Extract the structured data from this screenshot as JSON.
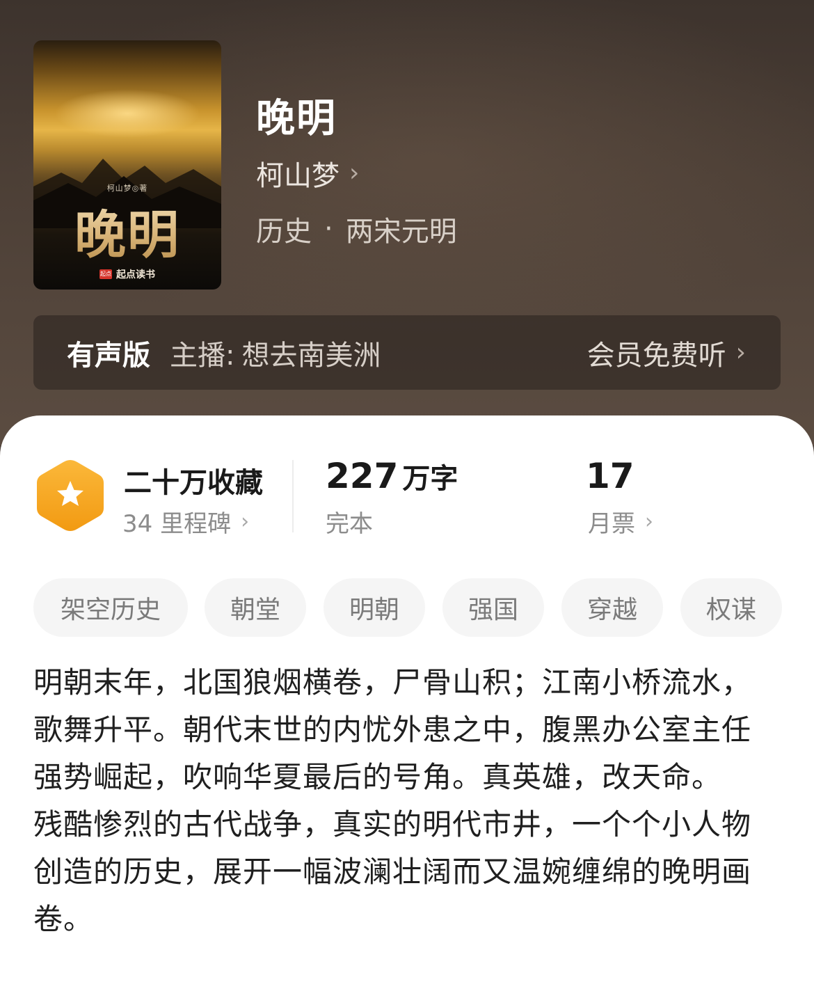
{
  "cover": {
    "title": "晚明",
    "author_line": "柯山梦◎著",
    "publisher": "起点读书",
    "publisher_logo": "起点"
  },
  "book": {
    "title": "晚明",
    "author": "柯山梦",
    "category": "历史",
    "separator": "·",
    "subcategory": "两宋元明"
  },
  "audio": {
    "label": "有声版",
    "host_label": "主播:",
    "host_name": "想去南美洲",
    "vip_link": "会员免费听"
  },
  "stats": {
    "collections": "二十万收藏",
    "milestones": "34 里程碑",
    "word_count": "227",
    "word_unit": "万字",
    "status": "完本",
    "monthly_tickets": "17",
    "ticket_label": "月票"
  },
  "tags": [
    "架空历史",
    "朝堂",
    "明朝",
    "强国",
    "穿越",
    "权谋"
  ],
  "description": [
    "明朝末年，北国狼烟横卷，尸骨山积；江南小桥流水，歌舞升平。朝代末世的内忧外患之中，腹黑办公室主任强势崛起，吹响华夏最后的号角。真英雄，改天命。",
    "残酷惨烈的古代战争，真实的明代市井，一个个小人物创造的历史，展开一幅波澜壮阔而又温婉缠绵的晚明画卷。"
  ],
  "colors": {
    "header_bg": "#4a3e37",
    "badge_orange": "#f7a21b",
    "text_primary": "#1a1a1a",
    "text_secondary": "#8c8c8c",
    "tag_bg": "#f5f5f5"
  },
  "icons": [
    "chevron-right-icon",
    "star-badge-icon"
  ]
}
